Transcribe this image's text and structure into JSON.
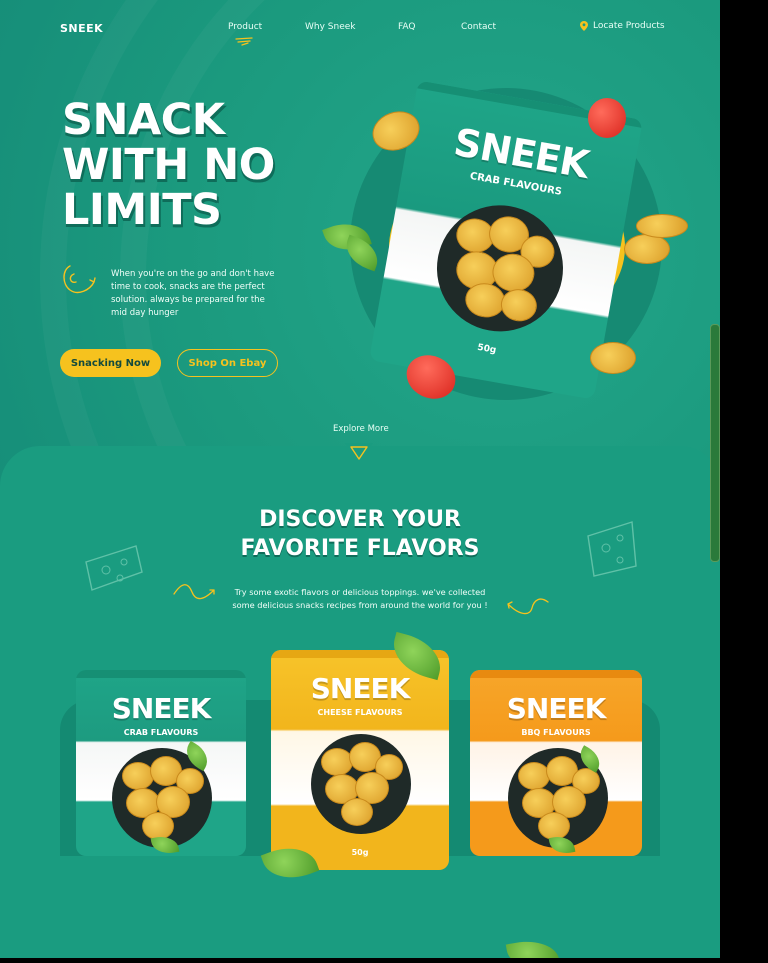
{
  "nav": {
    "logo": "SNEEK",
    "items": [
      "Product",
      "Why Sneek",
      "FAQ",
      "Contact"
    ],
    "locate": "Locate Products"
  },
  "hero": {
    "title_lines": [
      "SNACK",
      "WITH NO",
      "LIMITS"
    ],
    "description": "When you're on the go and don't have time to cook, snacks are the perfect solution. always be prepared for the mid day hunger",
    "primary_button": "Snacking Now",
    "secondary_button": "Shop On Ebay",
    "bag": {
      "brand": "SNEEK",
      "flavour": "CRAB FLAVOURS",
      "weight": "50g"
    }
  },
  "explore": "Explore More",
  "flavors": {
    "title_line1": "DISCOVER YOUR",
    "title_line2": "FAVORITE FLAVORS",
    "description": "Try some exotic flavors or delicious toppings. we've collected some delicious snacks recipes from around the world for you !",
    "bags": [
      {
        "brand": "SNEEK",
        "flavour": "CRAB FLAVOURS",
        "weight": "",
        "color": "#1d9b80"
      },
      {
        "brand": "SNEEK",
        "flavour": "CHEESE FLAVOURS",
        "weight": "50g",
        "color": "#f2b51c"
      },
      {
        "brand": "SNEEK",
        "flavour": "BBQ FLAVOURS",
        "weight": "",
        "color": "#f59a1b"
      }
    ]
  },
  "colors": {
    "teal": "#1a9c80",
    "yellow": "#f6c21e",
    "orange": "#f59a1b"
  }
}
